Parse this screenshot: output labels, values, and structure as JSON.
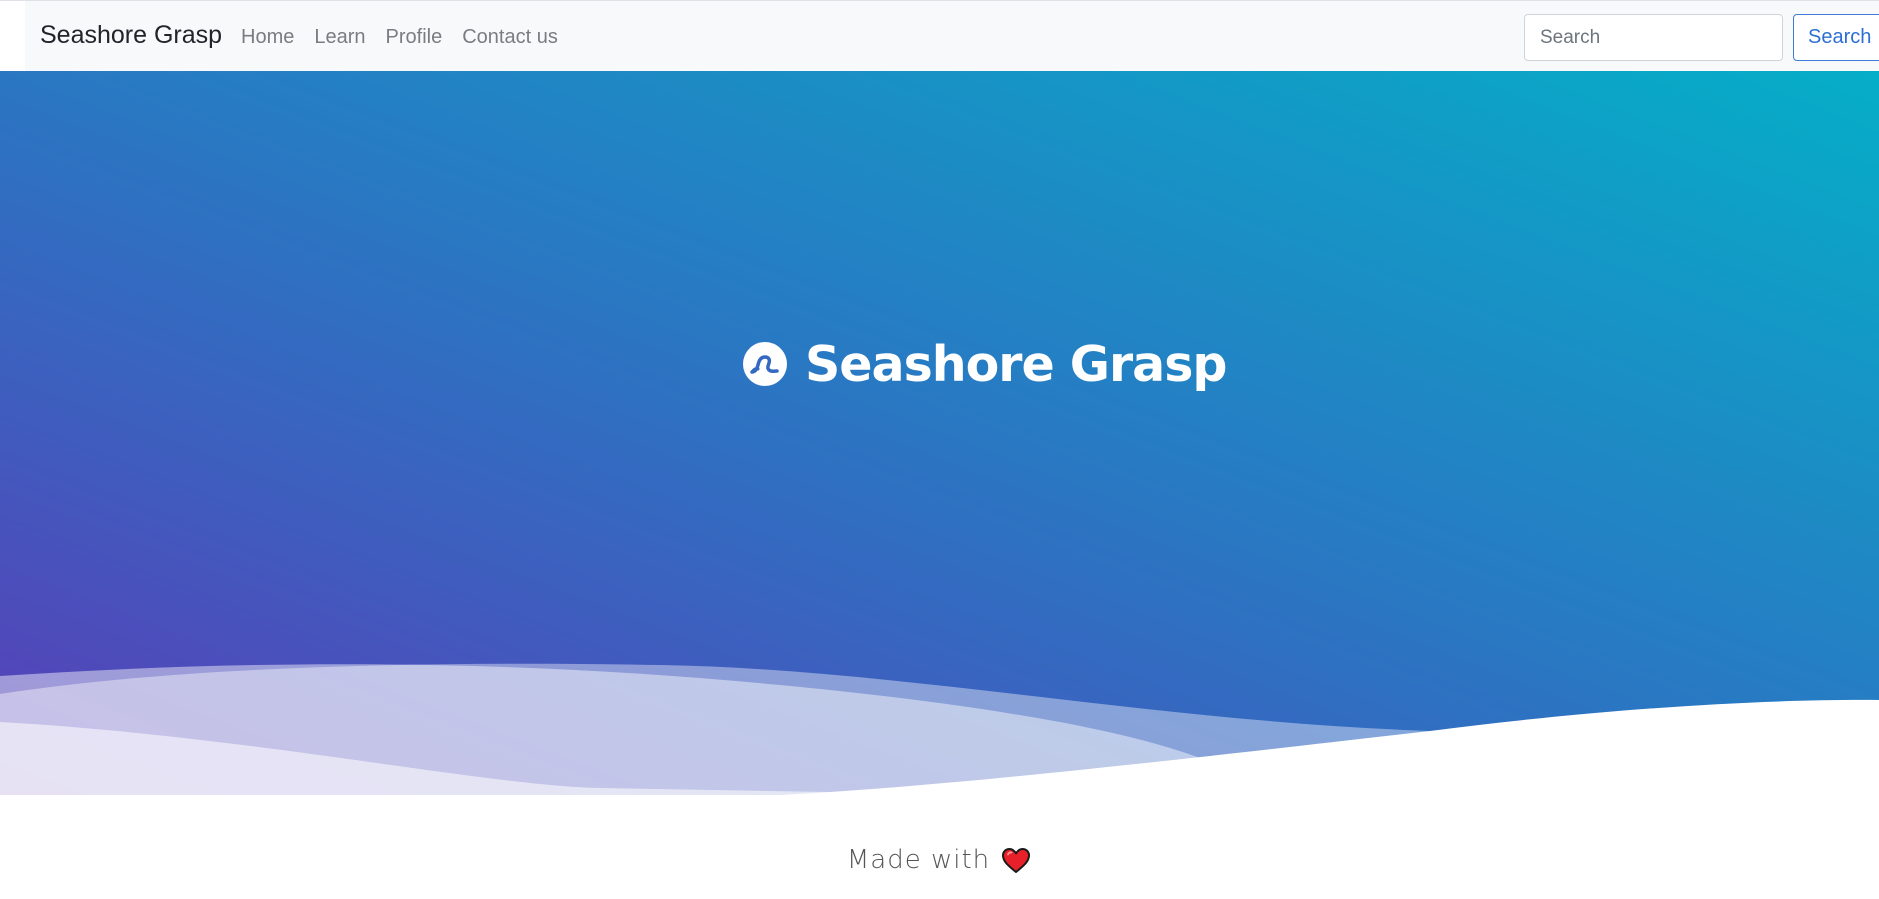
{
  "navbar": {
    "brand": "Seashore Grasp",
    "links": [
      {
        "label": "Home"
      },
      {
        "label": "Learn"
      },
      {
        "label": "Profile"
      },
      {
        "label": "Contact us"
      }
    ],
    "search": {
      "placeholder": "Search",
      "value": "",
      "button_label": "Search"
    }
  },
  "hero": {
    "title": "Seashore Grasp",
    "icon": "wave-logo-icon",
    "gradient_colors": [
      "#5a3db8",
      "#2e71c2",
      "#05aec8"
    ]
  },
  "footer": {
    "text": "Made with",
    "icon": "heart-icon",
    "heart_color": "#e8202a"
  }
}
